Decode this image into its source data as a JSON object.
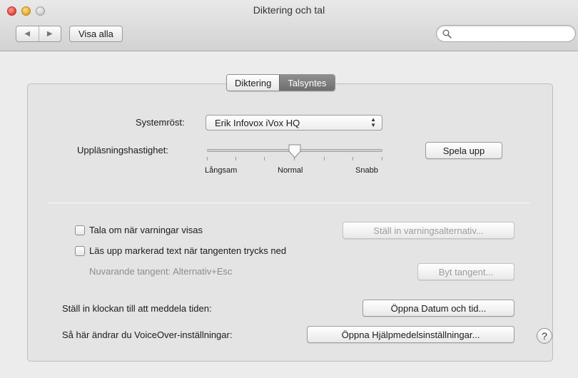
{
  "window": {
    "title": "Diktering och tal"
  },
  "toolbar": {
    "back_icon": "◀",
    "forward_icon": "▶",
    "show_all_label": "Visa alla",
    "search_placeholder": ""
  },
  "tabs": [
    {
      "label": "Diktering",
      "selected": false
    },
    {
      "label": "Talsyntes",
      "selected": true
    }
  ],
  "speech": {
    "system_voice_label": "Systemröst:",
    "system_voice_value": "Erik Infovox iVox HQ",
    "rate_label": "Uppläsningshastighet:",
    "rate_min_label": "Långsam",
    "rate_mid_label": "Normal",
    "rate_max_label": "Snabb",
    "rate_value_fraction": 0.5,
    "play_button": "Spela upp"
  },
  "options": {
    "announce_alerts_label": "Tala om när varningar visas",
    "announce_alerts_checked": false,
    "alert_options_button": "Ställ in varningsalternativ...",
    "speak_selected_label": "Läs upp markerad text när tangenten trycks ned",
    "speak_selected_checked": false,
    "current_key_label": "Nuvarande tangent: Alternativ+Esc",
    "change_key_button": "Byt tangent...",
    "clock_label": "Ställ in klockan till att meddela tiden:",
    "clock_button": "Öppna Datum och tid...",
    "voiceover_label": "Så här ändrar du VoiceOver-inställningar:",
    "voiceover_button": "Öppna Hjälpmedelsinställningar...",
    "help_button": "?"
  }
}
